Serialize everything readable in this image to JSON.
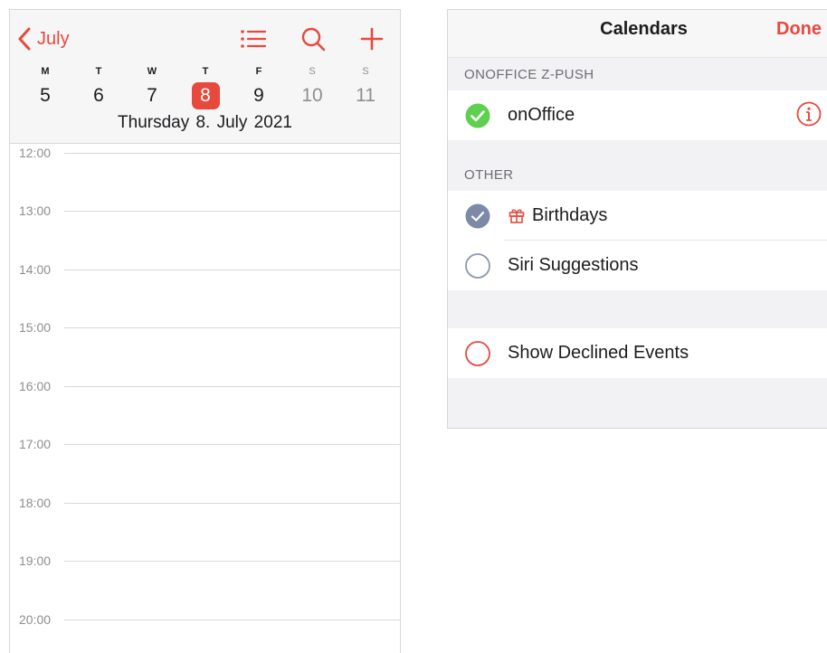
{
  "day_view": {
    "back_label": "July",
    "week": [
      {
        "dow": "M",
        "num": "5",
        "weekend": false,
        "selected": false
      },
      {
        "dow": "T",
        "num": "6",
        "weekend": false,
        "selected": false
      },
      {
        "dow": "W",
        "num": "7",
        "weekend": false,
        "selected": false
      },
      {
        "dow": "T",
        "num": "8",
        "weekend": false,
        "selected": true
      },
      {
        "dow": "F",
        "num": "9",
        "weekend": false,
        "selected": false
      },
      {
        "dow": "S",
        "num": "10",
        "weekend": true,
        "selected": false
      },
      {
        "dow": "S",
        "num": "11",
        "weekend": true,
        "selected": false
      }
    ],
    "selected_date": "Thursday  8. July 2021",
    "hours": [
      "12:00",
      "13:00",
      "14:00",
      "15:00",
      "16:00",
      "17:00",
      "18:00",
      "19:00",
      "20:00"
    ]
  },
  "calendars": {
    "title": "Calendars",
    "done_label": "Done",
    "section_account": "ONOFFICE Z-PUSH",
    "onoffice_label": "onOffice",
    "section_other": "OTHER",
    "birthdays_label": "Birthdays",
    "siri_label": "Siri Suggestions",
    "declined_label": "Show Declined Events",
    "checked": {
      "onOffice": true,
      "Birthdays": true,
      "Siri Suggestions": false,
      "Show Declined Events": false
    }
  },
  "colors": {
    "accent": "#e8493d",
    "onoffice_check": "#5fcf4f",
    "birthdays_check": "#7d8aa6",
    "siri_ring": "#8c97b0"
  },
  "icons": [
    "chevron-left-icon",
    "list-icon",
    "search-icon",
    "add-icon",
    "checkmark-circle-icon",
    "info-icon",
    "gift-icon"
  ]
}
